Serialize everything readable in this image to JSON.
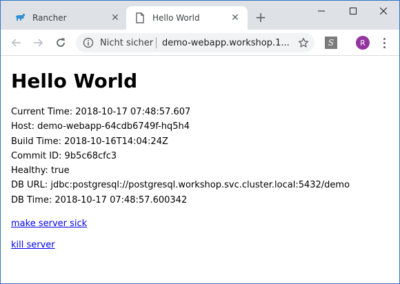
{
  "browser": {
    "tabs": [
      {
        "title": "Rancher",
        "close": "✕"
      },
      {
        "title": "Hello World",
        "close": "✕"
      }
    ],
    "new_tab": "+",
    "omnibox": {
      "security_text": "Nicht sicher",
      "url": "demo-webapp.workshop.1..."
    },
    "profile_initial": "R",
    "extension_label": "S"
  },
  "page": {
    "title": "Hello World",
    "lines": [
      "Current Time: 2018-10-17 07:48:57.607",
      "Host: demo-webapp-64cdb6749f-hq5h4",
      "Build Time: 2018-10-16T14:04:24Z",
      "Commit ID: 9b5c68cfc3",
      "Healthy: true",
      "DB URL: jdbc:postgresql://postgresql.workshop.svc.cluster.local:5432/demo",
      "DB Time: 2018-10-17 07:48:57.600342"
    ],
    "links": {
      "make_sick": "make server sick",
      "kill": "kill server"
    }
  },
  "colors": {
    "link": "#0000ee",
    "titlebar": "#dee1e6",
    "avatar": "#9334a0"
  }
}
